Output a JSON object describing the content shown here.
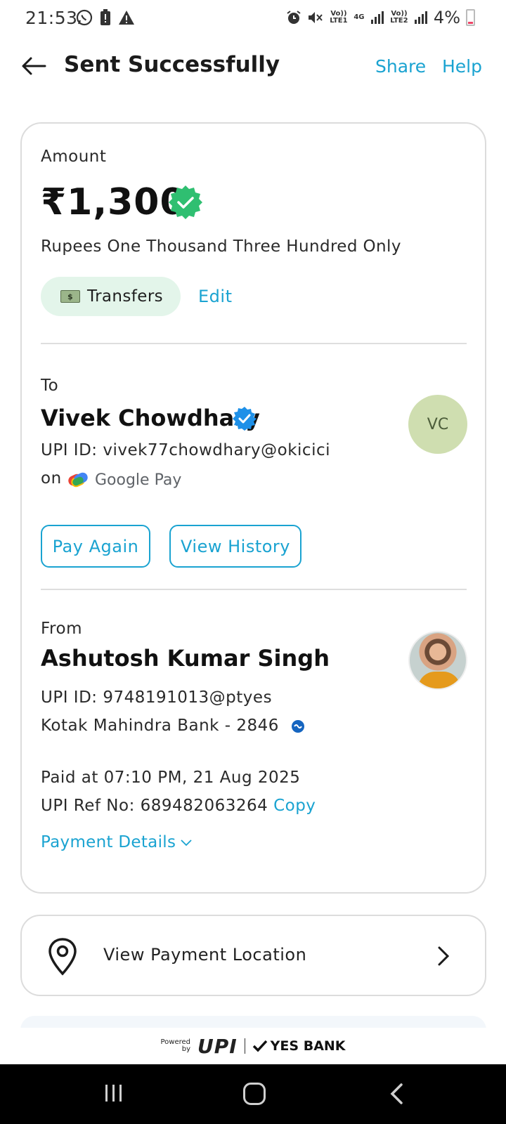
{
  "status_bar": {
    "time": "21:53",
    "battery": "4%",
    "network_labels": [
      "Vo)) LTE1",
      "4G",
      "Vo)) LTE2"
    ],
    "icons": [
      "whatsapp-icon",
      "battery-alert-icon",
      "warning-icon",
      "alarm-icon",
      "mute-icon",
      "signal-icon"
    ]
  },
  "header": {
    "title": "Sent Successfully",
    "share": "Share",
    "help": "Help"
  },
  "amount_section": {
    "label": "Amount",
    "amount": "₹1,300",
    "words": "Rupees One Thousand Three Hundred Only",
    "category": "Transfers",
    "edit": "Edit"
  },
  "to_section": {
    "label": "To",
    "name": "Vivek Chowdhary",
    "upi_id": "UPI ID: vivek77chowdhary@okicici",
    "on_label": "on",
    "app": "Google Pay",
    "avatar_initials": "VC",
    "pay_again": "Pay Again",
    "view_history": "View History"
  },
  "from_section": {
    "label": "From",
    "name": "Ashutosh Kumar Singh",
    "upi_id": "UPI ID: 9748191013@ptyes",
    "bank": "Kotak Mahindra Bank - 2846",
    "paid_at": "Paid at 07:10 PM, 21 Aug 2025",
    "ref_prefix": "UPI Ref No: 689482063264",
    "copy": "Copy",
    "payment_details": "Payment Details"
  },
  "location": {
    "label": "View Payment Location"
  },
  "footer": {
    "powered": "Powered",
    "by": "by",
    "upi": "UPI",
    "bank": "YES BANK"
  },
  "colors": {
    "accent": "#1aa3d1",
    "success": "#2fbf71",
    "chip_bg": "#e3f5ea",
    "avatar_bg": "#cfdeb0"
  }
}
